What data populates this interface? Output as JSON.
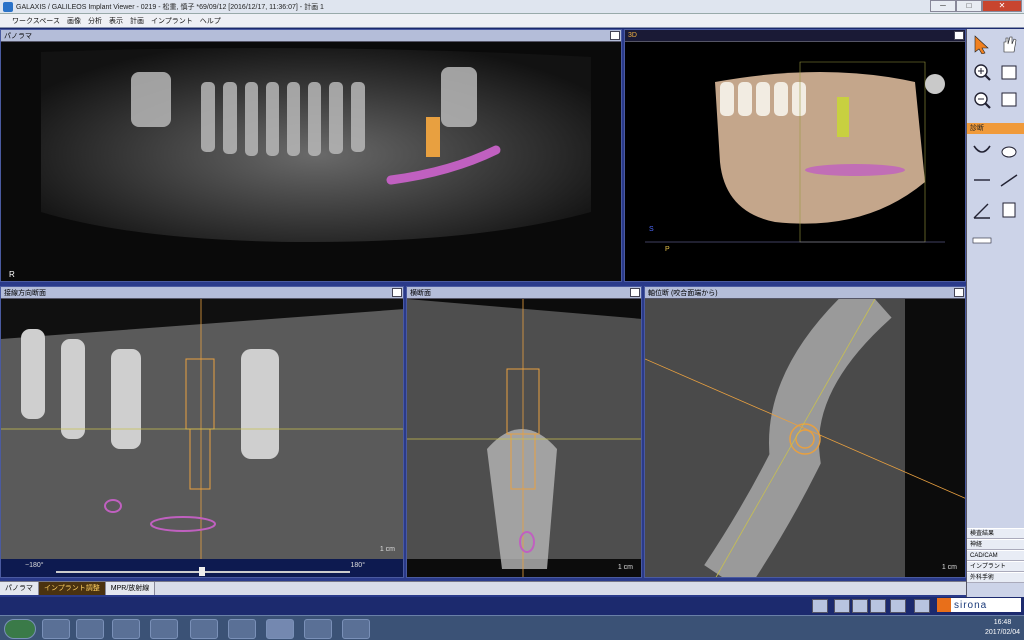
{
  "window": {
    "title": "GALAXIS / GALILEOS Implant Viewer - 0219 - 松重, 慎子 *69/09/12 [2016/12/17, 11:36:07] - 計画 1",
    "min": "─",
    "max": "□",
    "close": "✕"
  },
  "menu": [
    "ワークスペース",
    "画像",
    "分析",
    "表示",
    "計画",
    "インプラント",
    "ヘルプ"
  ],
  "panes": {
    "panorama": {
      "title": "パノラマ",
      "marker": "R"
    },
    "view3d": {
      "title": "3D",
      "axis_s": "S",
      "axis_p": "P"
    },
    "tangential": {
      "title": "接線方向断面",
      "scale": "1 cm",
      "slider_min": "−180°",
      "slider_max": "180°"
    },
    "cross": {
      "title": "横断面",
      "scale": "1 cm"
    },
    "axial": {
      "title": "軸位断 (咬合面端から)",
      "scale": "1 cm"
    }
  },
  "toolbar": {
    "section_label": "診断",
    "side_items": [
      "検査結果",
      "神経",
      "CAD/CAM",
      "インプラント",
      "外科手術"
    ]
  },
  "bottom_tabs": [
    "パノラマ",
    "インプラント調整",
    "MPR/放射線"
  ],
  "bottom_tab_active": 1,
  "brand": "sirona",
  "taskbar": {
    "time": "16:48",
    "date": "2017/02/04"
  },
  "colors": {
    "accent": "#f09a3a",
    "implant": "#e8a040",
    "nerve": "#c060c0"
  }
}
